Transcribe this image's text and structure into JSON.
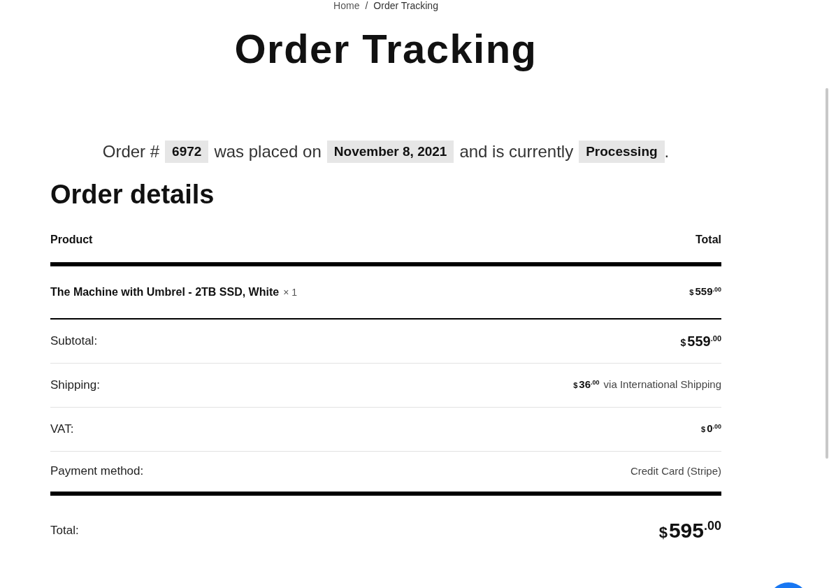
{
  "breadcrumb": [
    {
      "label": "Home",
      "kind": "link"
    },
    {
      "label": "Order Tracking",
      "kind": "current"
    }
  ],
  "breadcrumb_separator": "/",
  "title": "Order Tracking",
  "notice": {
    "parts": [
      {
        "text": "Order #",
        "kind": "plain"
      },
      {
        "text": "6972",
        "kind": "mark"
      },
      {
        "text": "was placed on",
        "kind": "plain"
      },
      {
        "text": "November 8, 2021",
        "kind": "mark"
      },
      {
        "text": "and is currently",
        "kind": "plain"
      },
      {
        "text": "Processing",
        "kind": "mark"
      },
      {
        "text": ".",
        "kind": "plain"
      }
    ]
  },
  "order_details": {
    "heading": "Order details",
    "columns": [
      "Product",
      "Total"
    ],
    "items": [
      {
        "name": "The Machine with Umbrel - 2TB SSD, White",
        "quantity": "× 1",
        "price": {
          "currency": "$",
          "amount": "559",
          "cents": ".00"
        }
      }
    ],
    "totals": [
      {
        "label": "Subtotal:",
        "kind": "price",
        "price": {
          "currency": "$",
          "amount": "559",
          "cents": ".00"
        }
      },
      {
        "label": "Shipping:",
        "kind": "price",
        "price": {
          "currency": "$",
          "amount": "36",
          "cents": ".00"
        },
        "note": "via International Shipping"
      },
      {
        "label": "VAT:",
        "kind": "price",
        "price": {
          "currency": "$",
          "amount": "0",
          "cents": ".00"
        }
      },
      {
        "label": "Payment method:",
        "kind": "text",
        "value": "Credit Card (Stripe)"
      },
      {
        "label": "Total:",
        "kind": "grand",
        "price": {
          "currency": "$",
          "amount": "595",
          "cents": ".00"
        }
      }
    ]
  }
}
